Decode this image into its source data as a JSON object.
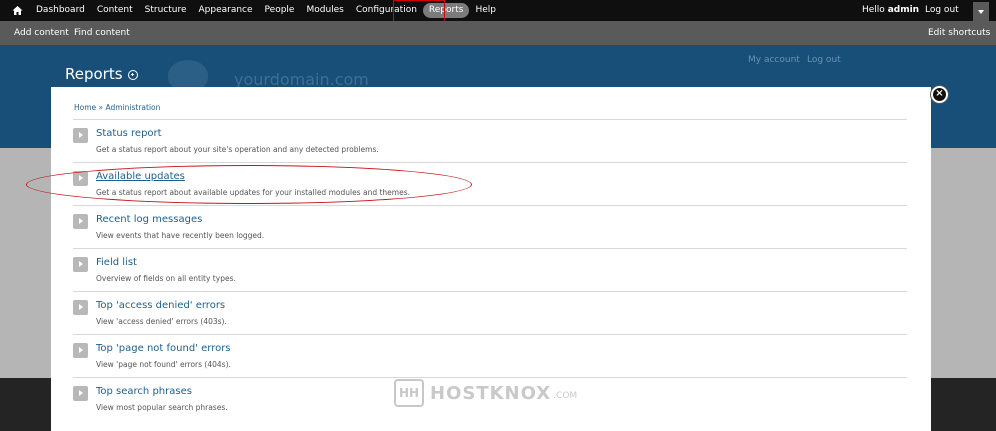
{
  "toolbar": {
    "menu": [
      "Dashboard",
      "Content",
      "Structure",
      "Appearance",
      "People",
      "Modules",
      "Configuration",
      "Reports",
      "Help"
    ],
    "hello_prefix": "Hello",
    "user": "admin",
    "logout": "Log out"
  },
  "shortcuts": {
    "add_content": "Add content",
    "find_content": "Find content",
    "edit_shortcuts": "Edit shortcuts"
  },
  "header": {
    "title": "Reports",
    "site_name": "yourdomain.com",
    "my_account": "My account",
    "log_out": "Log out"
  },
  "overlay": {
    "breadcrumb": "Home » Administration",
    "close_label": "×",
    "items": [
      {
        "title": "Status report",
        "desc": "Get a status report about your site's operation and any detected problems."
      },
      {
        "title": "Available updates",
        "desc": "Get a status report about available updates for your installed modules and themes."
      },
      {
        "title": "Recent log messages",
        "desc": "View events that have recently been logged."
      },
      {
        "title": "Field list",
        "desc": "Overview of fields on all entity types."
      },
      {
        "title": "Top 'access denied' errors",
        "desc": "View 'access denied' errors (403s)."
      },
      {
        "title": "Top 'page not found' errors",
        "desc": "View 'page not found' errors (404s)."
      },
      {
        "title": "Top search phrases",
        "desc": "View most popular search phrases."
      }
    ]
  },
  "watermark": {
    "icon": "HH",
    "text": "HOSTKNOX",
    "suffix": ".COM"
  },
  "colors": {
    "toolbar": "#0f0f0f",
    "shortcuts": "#5a5a5a",
    "header": "#174f79",
    "link": "#1c5f8f",
    "highlight": "#d00000"
  }
}
